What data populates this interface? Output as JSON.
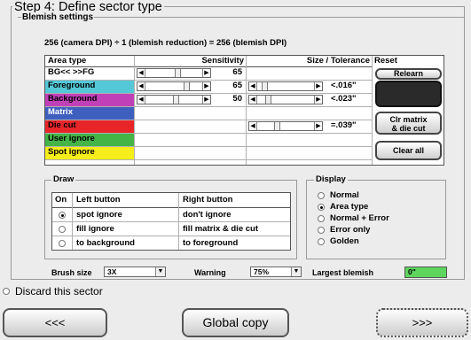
{
  "step_title": "Step 4: Define sector type",
  "blemish": {
    "title": "Blemish settings",
    "formula": "256 (camera DPI) ÷ 1 (blemish reduction) = 256 (blemish DPI)"
  },
  "table": {
    "headers": {
      "area": "Area type",
      "sensitivity": "Sensitivity",
      "size": "Size / Tolerance",
      "reset": "Reset"
    },
    "rows": [
      {
        "label": "BG<< >>FG",
        "sensitivity": "65",
        "size": ""
      },
      {
        "label": "Foreground",
        "sensitivity": "65",
        "size": "<.016\""
      },
      {
        "label": "Background",
        "sensitivity": "50",
        "size": "<.023\""
      },
      {
        "label": "Matrix",
        "sensitivity": "",
        "size": ""
      },
      {
        "label": "Die cut",
        "sensitivity": "",
        "size": "=.039\""
      },
      {
        "label": "User ignore",
        "sensitivity": "",
        "size": ""
      },
      {
        "label": "Spot ignore",
        "sensitivity": "",
        "size": ""
      }
    ],
    "row_colors": [
      "#ffffff",
      "#55c8d8",
      "#c040b8",
      "#3f5fbf",
      "#e8262a",
      "#44b447",
      "#f5ee1a"
    ],
    "buttons": {
      "relearn": "Relearn",
      "clr_matrix": "Clr matrix\n& die cut",
      "clear_all": "Clear all"
    }
  },
  "draw": {
    "title": "Draw",
    "headers": {
      "on": "On",
      "left": "Left button",
      "right": "Right button"
    },
    "rows": [
      {
        "left": "spot ignore",
        "right": "don't ignore",
        "selected": true
      },
      {
        "left": "fill ignore",
        "right": "fill matrix & die cut",
        "selected": false
      },
      {
        "left": "to background",
        "right": "to foreground",
        "selected": false
      }
    ]
  },
  "display": {
    "title": "Display",
    "options": [
      "Normal",
      "Area type",
      "Normal + Error",
      "Error only",
      "Golden"
    ],
    "selected": "Area type"
  },
  "bottom": {
    "brush_label": "Brush size",
    "brush_value": "3X",
    "warning_label": "Warning",
    "warning_value": "75%",
    "largest_label": "Largest blemish",
    "largest_value": "0\"",
    "largest_color": "#5ed65e"
  },
  "discard_label": "Discard this sector",
  "nav": {
    "prev": "<<<",
    "global": "Global copy",
    "next": ">>>"
  }
}
